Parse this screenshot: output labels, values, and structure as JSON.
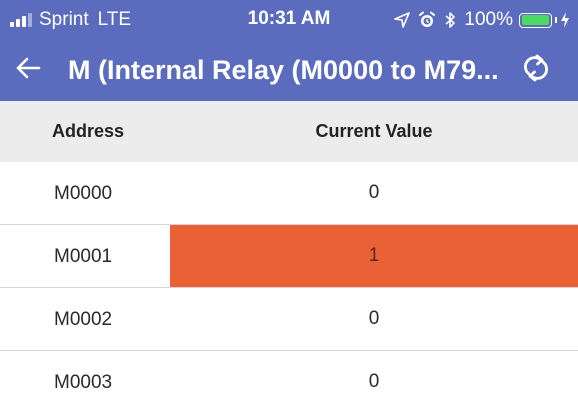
{
  "status_bar": {
    "carrier": "Sprint",
    "network": "LTE",
    "time": "10:31 AM",
    "battery": "100%",
    "battery_level": 1.0,
    "icons": [
      "signal-bars-icon",
      "location-arrow-icon",
      "alarm-clock-icon",
      "bluetooth-icon",
      "battery-icon",
      "charging-bolt-icon"
    ]
  },
  "header": {
    "title": "M (Internal Relay (M0000 to M79...",
    "back_icon": "back-arrow-icon",
    "refresh_icon": "refresh-icon"
  },
  "colors": {
    "header_bg": "#5b6bbd",
    "table_header_bg": "#ececec",
    "highlight": "#eb6137",
    "battery_fill": "#4cd964"
  },
  "table": {
    "columns": [
      "Address",
      "Current Value"
    ],
    "rows": [
      {
        "address": "M0000",
        "value": "0"
      },
      {
        "address": "M0001",
        "value": "1"
      },
      {
        "address": "M0002",
        "value": "0"
      },
      {
        "address": "M0003",
        "value": "0"
      }
    ]
  }
}
